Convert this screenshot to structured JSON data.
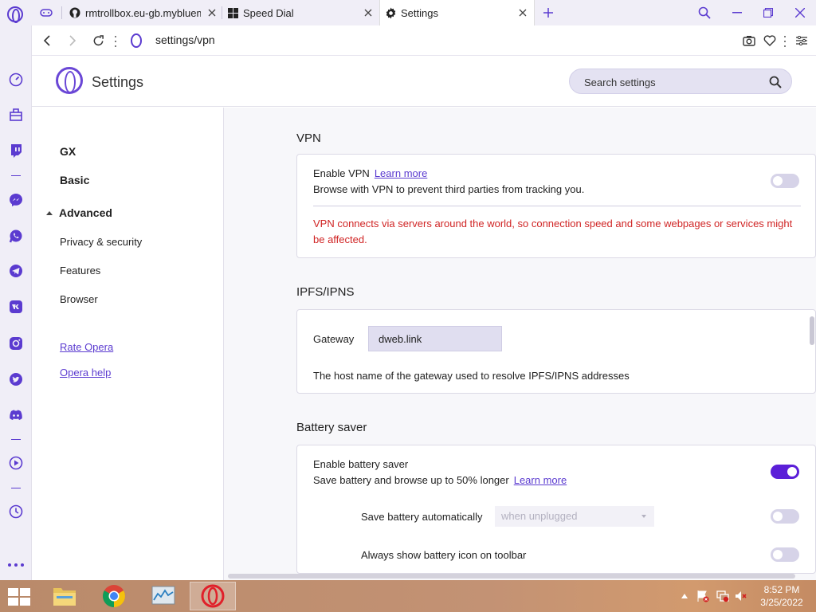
{
  "tabs": [
    {
      "label": "rmtrollbox.eu-gb.mybluem",
      "icon": "github-icon"
    },
    {
      "label": "Speed Dial",
      "icon": "speed-dial-icon"
    },
    {
      "label": "Settings",
      "icon": "gear-icon"
    }
  ],
  "address": {
    "url": "settings/vpn"
  },
  "header": {
    "title": "Settings",
    "search_placeholder": "Search settings"
  },
  "left_nav": {
    "gx": "GX",
    "basic": "Basic",
    "advanced": "Advanced",
    "privacy": "Privacy & security",
    "features": "Features",
    "browser": "Browser",
    "rate": "Rate Opera",
    "help": "Opera help"
  },
  "vpn": {
    "title": "VPN",
    "enable_label": "Enable VPN",
    "learn_more": "Learn more",
    "description": "Browse with VPN to prevent third parties from tracking you.",
    "enabled": false,
    "warning": "VPN connects via servers around the world, so connection speed and some webpages or services might be affected."
  },
  "ipfs": {
    "title": "IPFS/IPNS",
    "gateway_label": "Gateway",
    "gateway_value": "dweb.link",
    "description": "The host name of the gateway used to resolve IPFS/IPNS addresses"
  },
  "battery": {
    "title": "Battery saver",
    "enable_label": "Enable battery saver",
    "description": "Save battery and browse up to 50% longer",
    "learn_more": "Learn more",
    "enabled": true,
    "auto_label": "Save battery automatically",
    "auto_select": "when unplugged",
    "auto_enabled": false,
    "icon_label": "Always show battery icon on toolbar",
    "icon_enabled": false
  },
  "taskbar": {
    "apps": [
      "file-explorer-icon",
      "chrome-icon",
      "task-manager-icon",
      "opera-icon"
    ],
    "time": "8:52 PM",
    "date": "3/25/2022"
  },
  "colors": {
    "accent": "#5b3bd0",
    "warning": "#d02424",
    "toggle_on": "#5b1fd8"
  }
}
